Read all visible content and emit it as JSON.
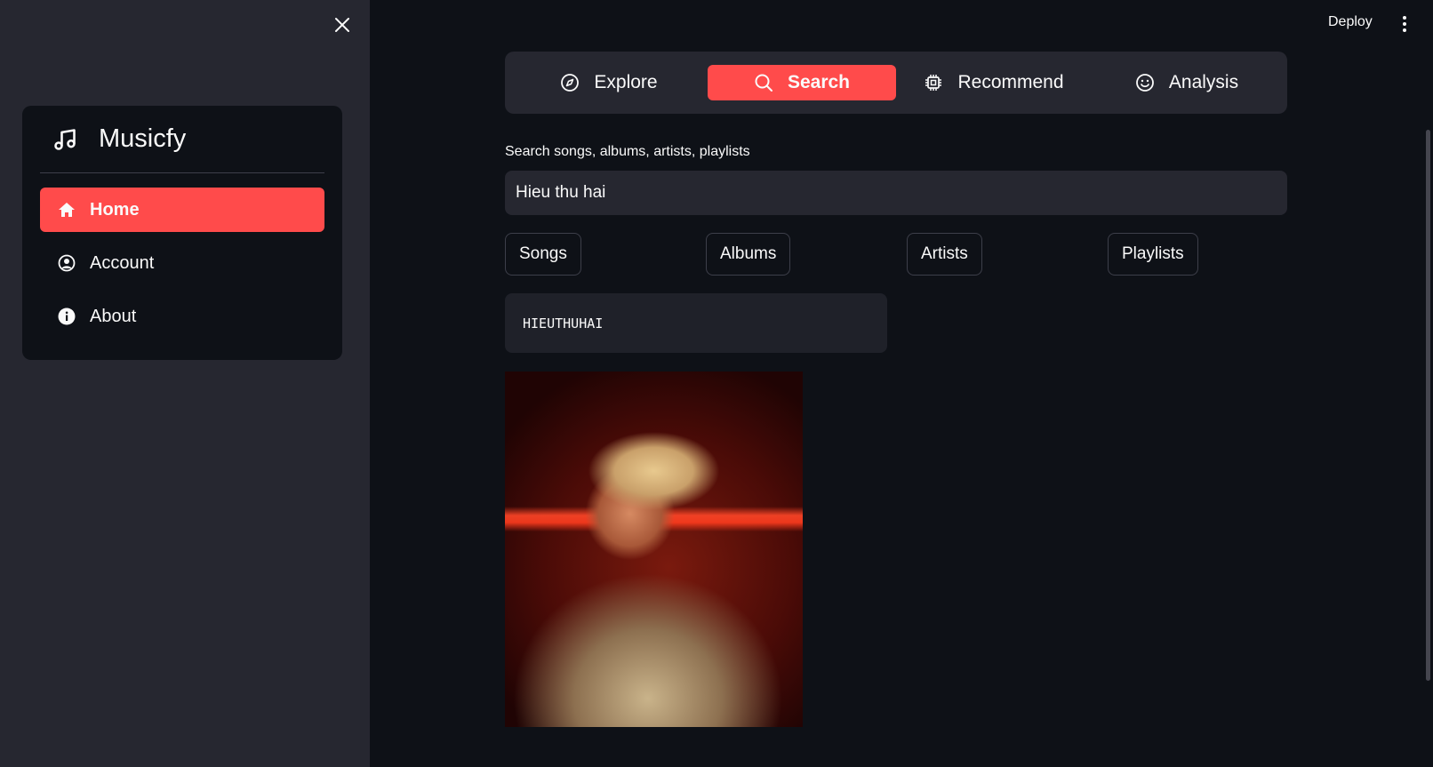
{
  "sidebar": {
    "brand": "Musicfy",
    "items": [
      {
        "label": "Home",
        "icon": "home-icon",
        "active": true
      },
      {
        "label": "Account",
        "icon": "user-circle-icon",
        "active": false
      },
      {
        "label": "About",
        "icon": "info-icon",
        "active": false
      }
    ]
  },
  "header": {
    "deploy_label": "Deploy"
  },
  "tabs": [
    {
      "label": "Explore",
      "icon": "compass-icon",
      "active": false
    },
    {
      "label": "Search",
      "icon": "search-icon",
      "active": true
    },
    {
      "label": "Recommend",
      "icon": "cpu-icon",
      "active": false
    },
    {
      "label": "Analysis",
      "icon": "smile-icon",
      "active": false
    }
  ],
  "search": {
    "label": "Search songs, albums, artists, playlists",
    "value": "Hieu thu hai"
  },
  "filters": [
    "Songs",
    "Albums",
    "Artists",
    "Playlists"
  ],
  "result": {
    "title": "HIEUTHUHAI"
  },
  "colors": {
    "accent": "#ff4b4b",
    "background": "#0e1117",
    "sidebar_bg": "#262730"
  }
}
